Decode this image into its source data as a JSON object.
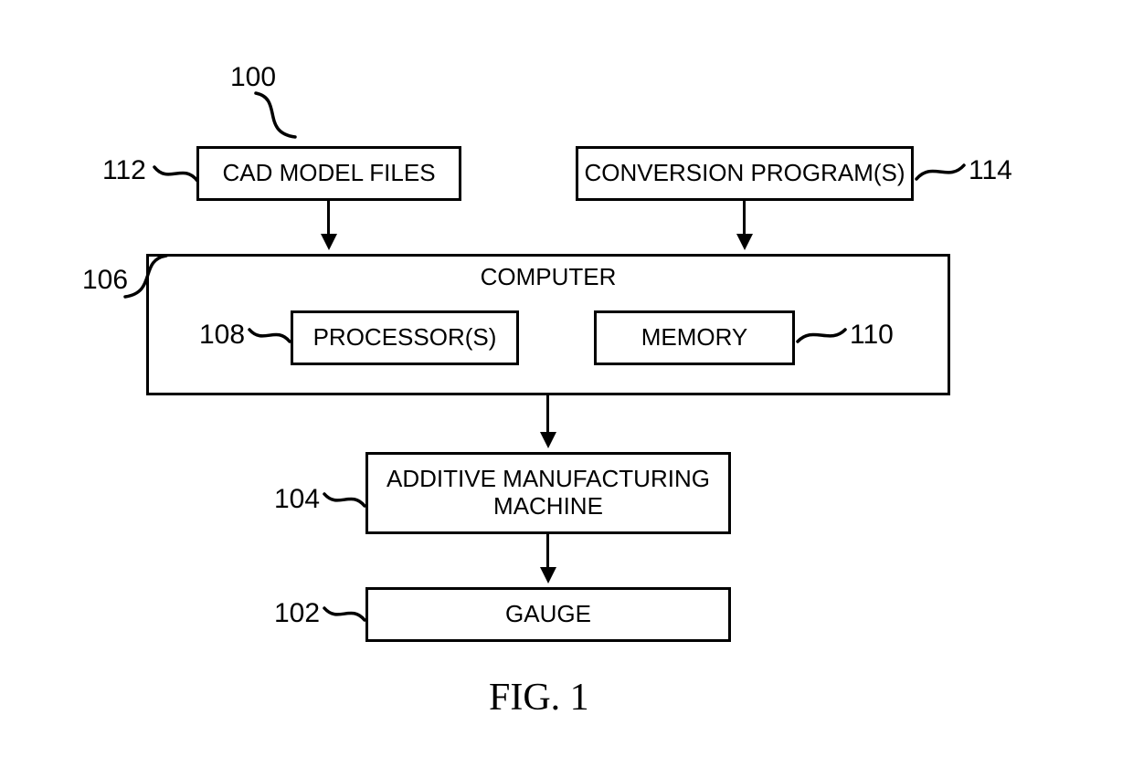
{
  "refs": {
    "r100": "100",
    "r112": "112",
    "r114": "114",
    "r106": "106",
    "r108": "108",
    "r110": "110",
    "r104": "104",
    "r102": "102"
  },
  "boxes": {
    "cad": "CAD MODEL FILES",
    "conversion": "CONVERSION PROGRAM(S)",
    "computer": "COMPUTER",
    "processors": "PROCESSOR(S)",
    "memory": "MEMORY",
    "additive": "ADDITIVE MANUFACTURING\nMACHINE",
    "gauge": "GAUGE"
  },
  "caption": "FIG. 1"
}
